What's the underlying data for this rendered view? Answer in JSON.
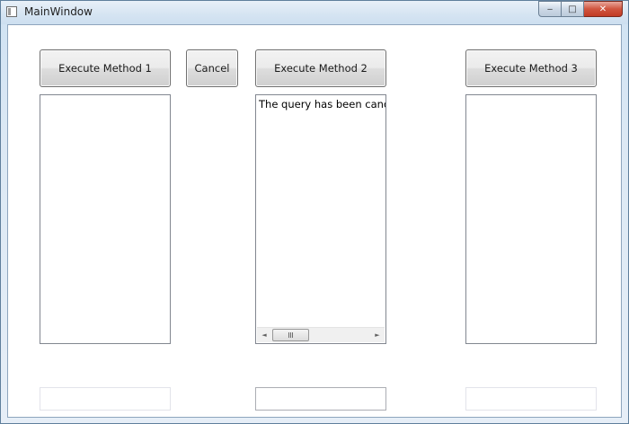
{
  "window": {
    "title": "MainWindow",
    "controls": {
      "minimize": "‒",
      "maximize": "□",
      "close": "✕"
    }
  },
  "columns": [
    {
      "button_label": "Execute Method 1",
      "list_text": "",
      "textbox_value": ""
    },
    {
      "button_label": "Execute Method 2",
      "list_text": "The query has been canceled",
      "textbox_value": ""
    },
    {
      "button_label": "Execute Method 3",
      "list_text": "",
      "textbox_value": ""
    }
  ],
  "cancel_button_label": "Cancel",
  "scrollbar": {
    "left_arrow": "◄",
    "right_arrow": "►"
  },
  "colors": {
    "frame": "#cfe2f3",
    "close_button": "#c23b24",
    "button_face": "#e6e6e6"
  }
}
